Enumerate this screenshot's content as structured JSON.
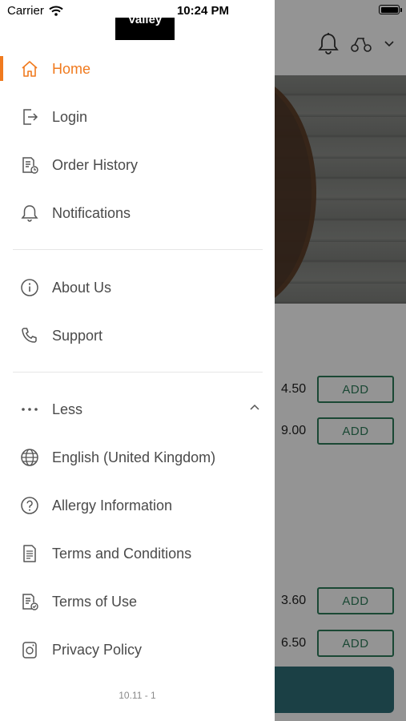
{
  "status_bar": {
    "carrier": "Carrier",
    "time": "10:24 PM"
  },
  "header": {
    "logo_text": "Valley"
  },
  "menu": {
    "primary": [
      {
        "label": "Home",
        "icon": "home-icon",
        "active": true
      },
      {
        "label": "Login",
        "icon": "login-icon"
      },
      {
        "label": "Order History",
        "icon": "order-history-icon"
      },
      {
        "label": "Notifications",
        "icon": "bell-icon"
      }
    ],
    "secondary": [
      {
        "label": "About Us",
        "icon": "info-icon"
      },
      {
        "label": "Support",
        "icon": "phone-icon"
      }
    ],
    "more": {
      "label": "Less",
      "icon": "ellipsis-icon",
      "toggle_icon": "chevron-up-icon"
    },
    "tertiary": [
      {
        "label": "English (United Kingdom)",
        "icon": "globe-icon"
      },
      {
        "label": "Allergy Information",
        "icon": "question-icon"
      },
      {
        "label": "Terms and Conditions",
        "icon": "document-icon"
      },
      {
        "label": "Terms of Use",
        "icon": "document-check-icon"
      },
      {
        "label": "Privacy Policy",
        "icon": "privacy-icon"
      }
    ]
  },
  "version": "10.11 - 1",
  "background": {
    "items": [
      {
        "price": "4.50",
        "button": "ADD"
      },
      {
        "price": "9.00",
        "button": "ADD"
      },
      {
        "price": "3.60",
        "button": "ADD"
      },
      {
        "price": "6.50",
        "button": "ADD"
      }
    ]
  },
  "colors": {
    "accent": "#f07a1e",
    "text": "#4a4a4a",
    "add_button": "#2e7d5b",
    "basket_bar": "#2f6f78"
  }
}
